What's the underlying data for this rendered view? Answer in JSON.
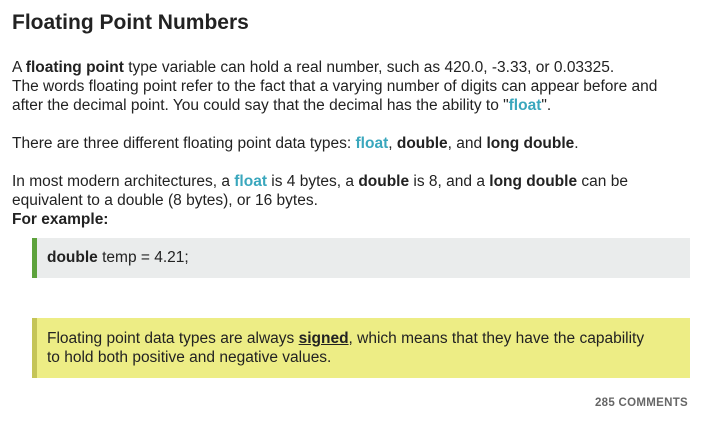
{
  "title": "Floating Point Numbers",
  "para1": {
    "a": "A ",
    "b_floating_point": "floating point",
    "c": " type variable can hold a real number, such as 420.0, -3.33, or 0.03325."
  },
  "para1_line2": "The words floating point refer to the fact that a varying number of digits can appear before and",
  "para1_line3": {
    "a": "after the decimal point. You could say that the decimal has the ability to \"",
    "kw_float": "float",
    "c": "\"."
  },
  "para2": {
    "a": "There are three different floating point data types: ",
    "kw_float": "float",
    "comma": ", ",
    "b_double": "double",
    "and": ", and ",
    "b_long_double": "long double",
    "end": "."
  },
  "para3": {
    "a": "In most modern architectures, a ",
    "kw_float": "float",
    "b": " is 4 bytes, a ",
    "b_double": "double",
    "c": " is 8, and a ",
    "b_long_double": "long double",
    "d": " can be"
  },
  "para3_line2": "equivalent to a double (8 bytes), or 16 bytes.",
  "for_example": "For example:",
  "code": {
    "keyword": "double",
    "rest": " temp = 4.21;"
  },
  "note": {
    "a": "Floating point data types are always ",
    "signed": "signed",
    "b": ", which means that they have the capability",
    "line2": "to hold both positive and negative values."
  },
  "comments_label": "285 COMMENTS",
  "colors": {
    "keyword_blue": "#3aa7bd",
    "code_border_green": "#5da23c",
    "code_bg": "#eaecec",
    "note_bg": "#eded85",
    "note_border": "#c4c457"
  }
}
